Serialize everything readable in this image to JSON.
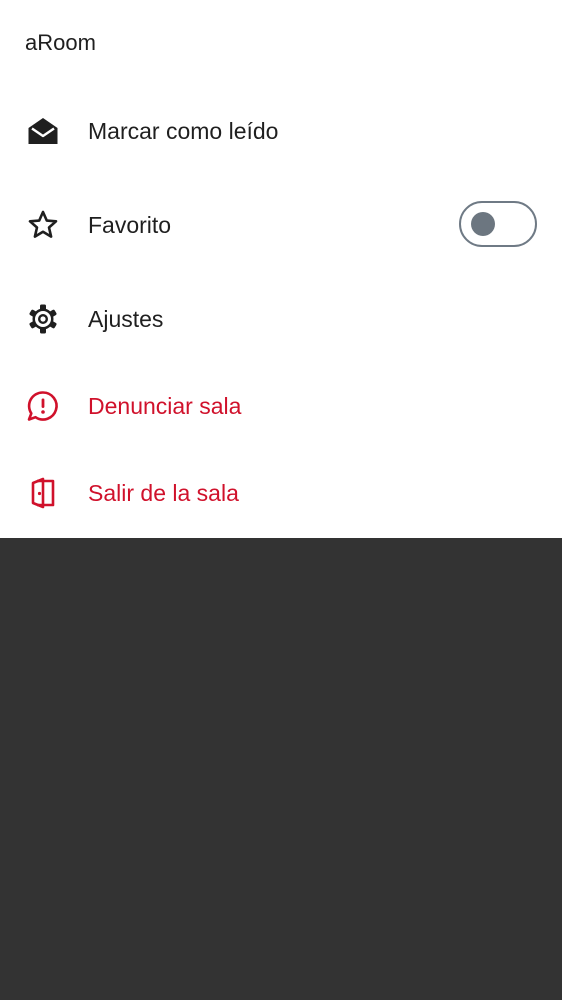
{
  "sheet": {
    "title": "aRoom",
    "items": [
      {
        "label": "Marcar como leído",
        "icon": "mail-open-icon"
      },
      {
        "label": "Favorito",
        "icon": "star-icon",
        "toggle": {
          "on": false
        }
      },
      {
        "label": "Ajustes",
        "icon": "gear-icon"
      },
      {
        "label": "Denunciar sala",
        "icon": "report-icon",
        "danger": true
      },
      {
        "label": "Salir de la sala",
        "icon": "leave-room-icon",
        "danger": true
      }
    ]
  },
  "colors": {
    "text": "#1f1f1f",
    "danger": "#d0112b",
    "overlay": "#333333",
    "toggle_border": "#6f7a85"
  }
}
